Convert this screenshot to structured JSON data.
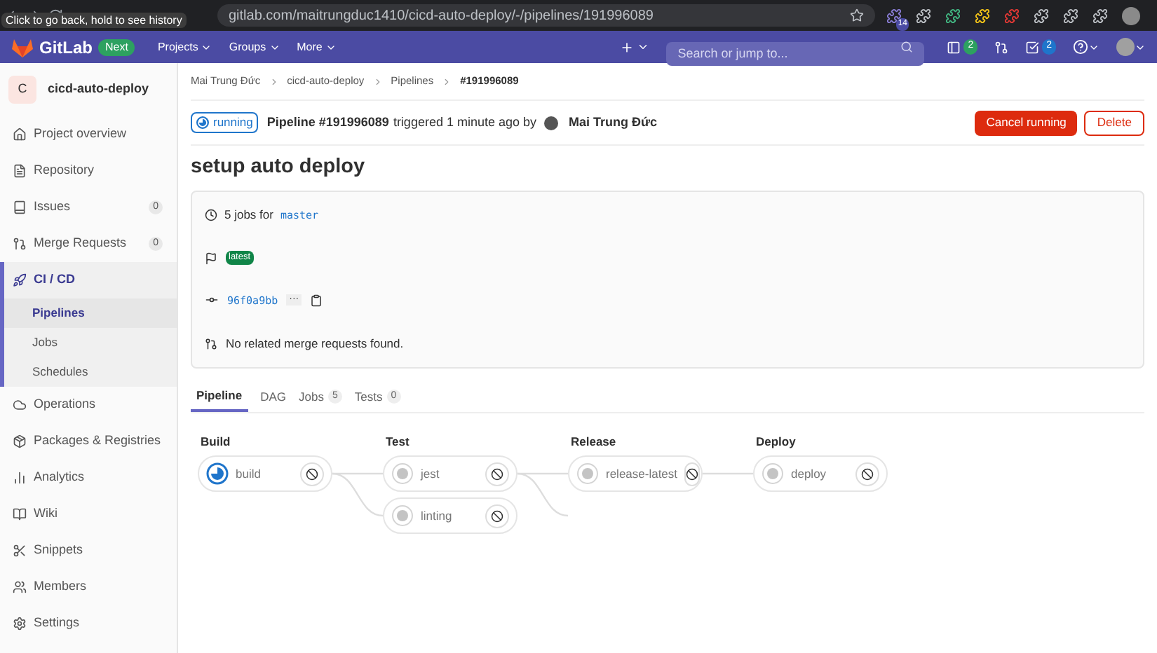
{
  "browser": {
    "url": "gitlab.com/maitrungduc1410/cicd-auto-deploy/-/pipelines/191996089",
    "tooltip": "Click to go back, hold to see history",
    "extension_badge": "14"
  },
  "navbar": {
    "brand": "GitLab",
    "badge": "Next",
    "menus": [
      "Projects",
      "Groups",
      "More"
    ],
    "search": {
      "placeholder": "Search or jump to..."
    },
    "counts": [
      "2",
      "2"
    ]
  },
  "sidebar": {
    "project_initial": "C",
    "project_name": "cicd-auto-deploy",
    "items": [
      {
        "label": "Project overview",
        "selected": false
      },
      {
        "label": "Repository",
        "selected": false
      },
      {
        "label": "Issues",
        "count": "0",
        "selected": false
      },
      {
        "label": "Merge Requests",
        "count": "0",
        "selected": false
      },
      {
        "label": "CI / CD",
        "selected": true,
        "children": [
          {
            "label": "Pipelines",
            "selected": true
          },
          {
            "label": "Jobs",
            "selected": false
          },
          {
            "label": "Schedules",
            "selected": false
          }
        ]
      },
      {
        "label": "Operations",
        "selected": false
      },
      {
        "label": "Packages & Registries",
        "selected": false
      },
      {
        "label": "Analytics",
        "selected": false
      },
      {
        "label": "Wiki",
        "selected": false
      },
      {
        "label": "Snippets",
        "selected": false
      },
      {
        "label": "Members",
        "selected": false
      },
      {
        "label": "Settings",
        "selected": false
      }
    ]
  },
  "breadcrumbs": [
    "Mai Trung Đức",
    "cicd-auto-deploy",
    "Pipelines",
    "#191996089"
  ],
  "header": {
    "status": "running",
    "pipeline": "Pipeline #191996089",
    "triggered": "triggered 1 minute ago by",
    "user": "Mai Trung Đức",
    "buttons": [
      "Cancel running",
      "Delete"
    ]
  },
  "title": "setup auto deploy",
  "info": {
    "jobs_text": "5 jobs for",
    "branch": "master",
    "tag": "latest",
    "commit": "96f0a9bb",
    "ellipsis": "···",
    "merge_requests": "No related merge requests found."
  },
  "tabs": [
    {
      "label": "Pipeline",
      "selected": true
    },
    {
      "label": "DAG",
      "selected": false
    },
    {
      "label": "Jobs",
      "count": "5",
      "selected": false
    },
    {
      "label": "Tests",
      "count": "0",
      "selected": false
    }
  ],
  "stages": [
    {
      "name": "Build",
      "jobs": [
        {
          "name": "build",
          "running": true
        }
      ]
    },
    {
      "name": "Test",
      "jobs": [
        {
          "name": "jest",
          "running": false
        },
        {
          "name": "linting",
          "running": false
        }
      ]
    },
    {
      "name": "Release",
      "jobs": [
        {
          "name": "release-latest",
          "running": false
        }
      ]
    },
    {
      "name": "Deploy",
      "jobs": [
        {
          "name": "deploy",
          "running": false
        }
      ]
    }
  ]
}
